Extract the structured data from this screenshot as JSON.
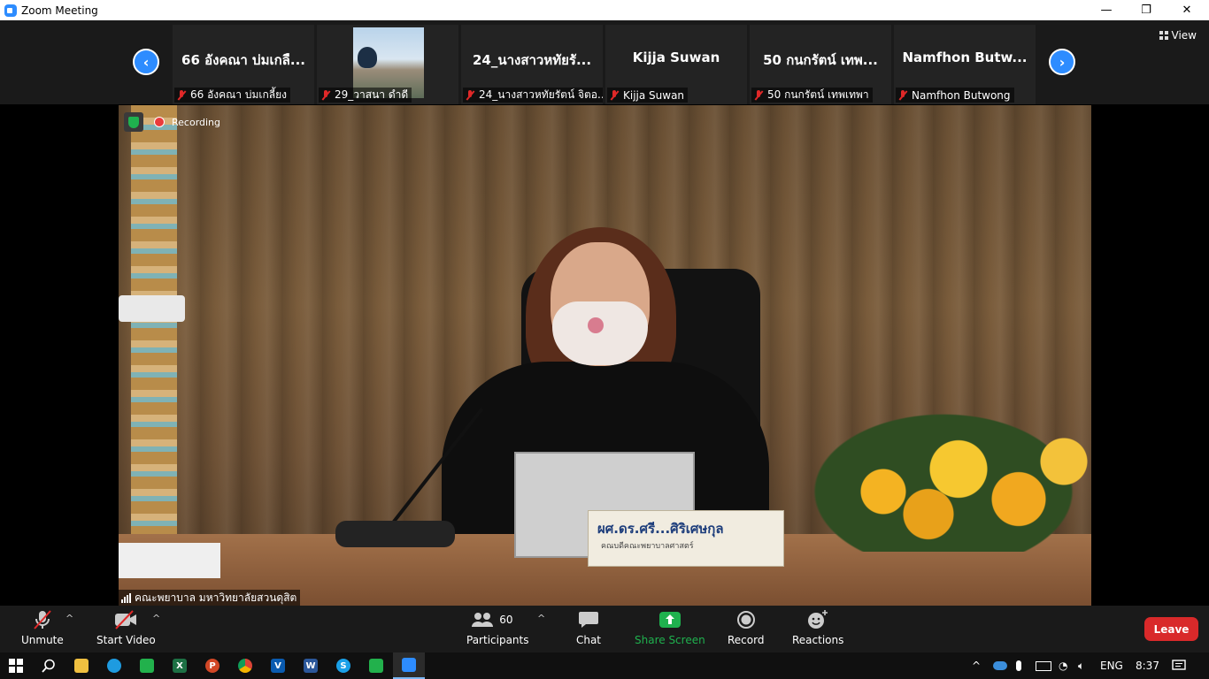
{
  "window": {
    "title": "Zoom Meeting",
    "minimize": "—",
    "restore": "❐",
    "close": "✕"
  },
  "gallery": {
    "prev": "‹",
    "next": "›",
    "view_label": "View",
    "tiles": [
      {
        "big": "66 อังคณา บ่มเกลื...",
        "small": "66 อังคณา บ่มเกลี้ยง",
        "has_photo": false
      },
      {
        "big": "",
        "small": "29_วาสนา ดำดี",
        "has_photo": true
      },
      {
        "big": "24_นางสาวหทัยรั...",
        "small": "24_นางสาวหทัยรัตน์ จิตอ...",
        "has_photo": false
      },
      {
        "big": "Kijja Suwan",
        "small": "Kijja Suwan",
        "has_photo": false
      },
      {
        "big": "50 กนกรัตน์ เทพ...",
        "small": "50 กนกรัตน์ เทพเทพา",
        "has_photo": false
      },
      {
        "big": "Namfhon Butw...",
        "small": "Namfhon Butwong",
        "has_photo": false
      }
    ]
  },
  "video": {
    "recording_label": "Recording",
    "speaker_name": "คณะพยาบาล มหาวิทยาลัยสวนดุสิต",
    "nameplate_line1": "ผศ.ดร.ศรี...ศิริเศษกุล",
    "nameplate_line2": "คณบดีคณะพยาบาลศาสตร์"
  },
  "toolbar": {
    "unmute": "Unmute",
    "start_video": "Start Video",
    "participants": "Participants",
    "participants_count": "60",
    "chat": "Chat",
    "share_screen": "Share Screen",
    "record": "Record",
    "reactions": "Reactions",
    "leave": "Leave",
    "caret": "^"
  },
  "taskbar": {
    "apps": [
      "windows-start",
      "search",
      "file-explorer",
      "edge",
      "line",
      "excel",
      "powerpoint",
      "chrome",
      "outlook",
      "word",
      "skype",
      "line-2",
      "zoom"
    ],
    "language": "ENG",
    "time": "8:37",
    "colors": {
      "accent": "#2d8cff",
      "leave": "#d9292a",
      "share": "#1fb14e"
    }
  }
}
